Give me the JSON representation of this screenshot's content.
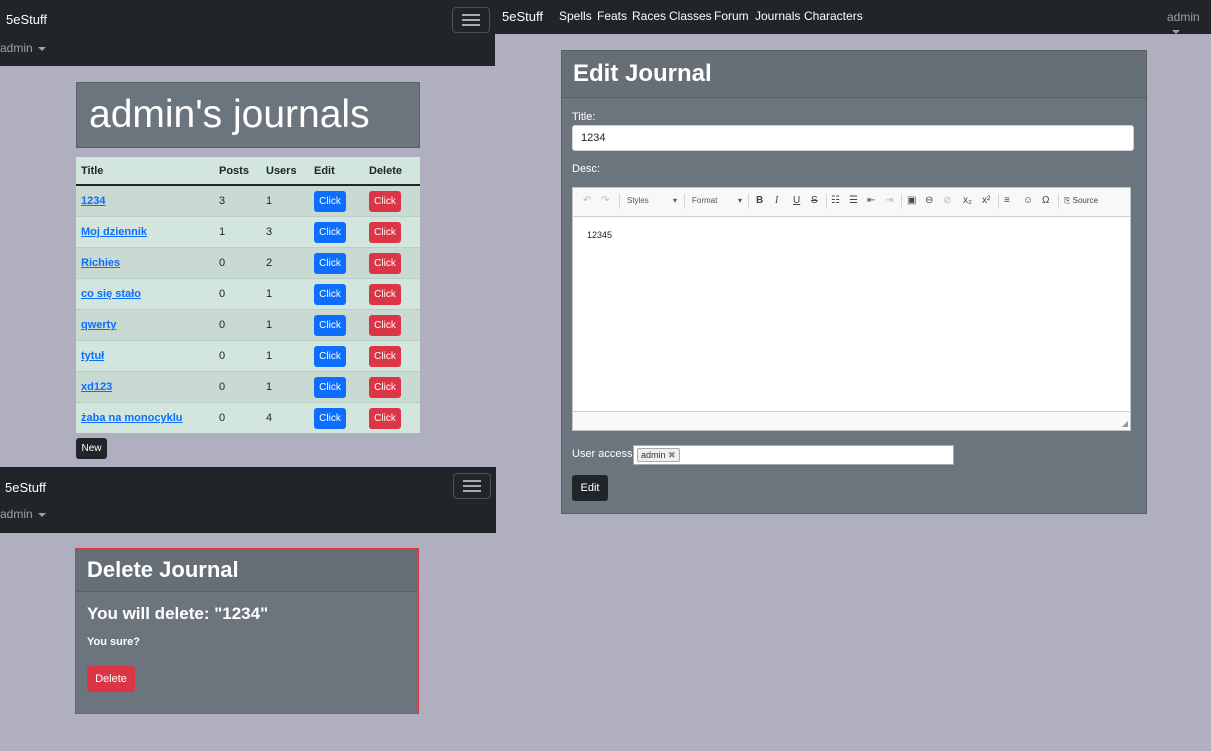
{
  "app": {
    "brand": "5eStuff",
    "user": "admin"
  },
  "top_nav": {
    "links": [
      "Spells",
      "Feats",
      "Races",
      "Classes",
      "Forum",
      "Journals",
      "Characters"
    ]
  },
  "journals": {
    "heading": "admin's journals",
    "columns": [
      "Title",
      "Posts",
      "Users",
      "Edit",
      "Delete"
    ],
    "rows": [
      {
        "title": "1234",
        "posts": "3",
        "users": "1",
        "edit": "Click",
        "delete": "Click"
      },
      {
        "title": "Moj dziennik",
        "posts": "1",
        "users": "3",
        "edit": "Click",
        "delete": "Click"
      },
      {
        "title": "Richies",
        "posts": "0",
        "users": "2",
        "edit": "Click",
        "delete": "Click"
      },
      {
        "title": "co się stało",
        "posts": "0",
        "users": "1",
        "edit": "Click",
        "delete": "Click"
      },
      {
        "title": "qwerty",
        "posts": "0",
        "users": "1",
        "edit": "Click",
        "delete": "Click"
      },
      {
        "title": "tytuł",
        "posts": "0",
        "users": "1",
        "edit": "Click",
        "delete": "Click"
      },
      {
        "title": "xd123",
        "posts": "0",
        "users": "1",
        "edit": "Click",
        "delete": "Click"
      },
      {
        "title": "żaba na monocyklu",
        "posts": "0",
        "users": "4",
        "edit": "Click",
        "delete": "Click"
      }
    ],
    "new_label": "New"
  },
  "delete_card": {
    "heading": "Delete Journal",
    "message": "You will delete: \"1234\"",
    "confirm": "You sure?",
    "button": "Delete"
  },
  "edit_card": {
    "heading": "Edit Journal",
    "title_label": "Title:",
    "title_value": "1234",
    "desc_label": "Desc:",
    "editor": {
      "styles_label": "Styles",
      "format_label": "Format",
      "source_label": "Source",
      "content": "12345"
    },
    "access_label": "User access:",
    "access_tags": [
      "admin"
    ],
    "button": "Edit"
  },
  "colors": {
    "navbar": "#212529",
    "card": "#6c757d",
    "background": "#b0afc0",
    "primary": "#0d6efd",
    "danger": "#dc3545",
    "table_row": "#d2e6dd"
  }
}
